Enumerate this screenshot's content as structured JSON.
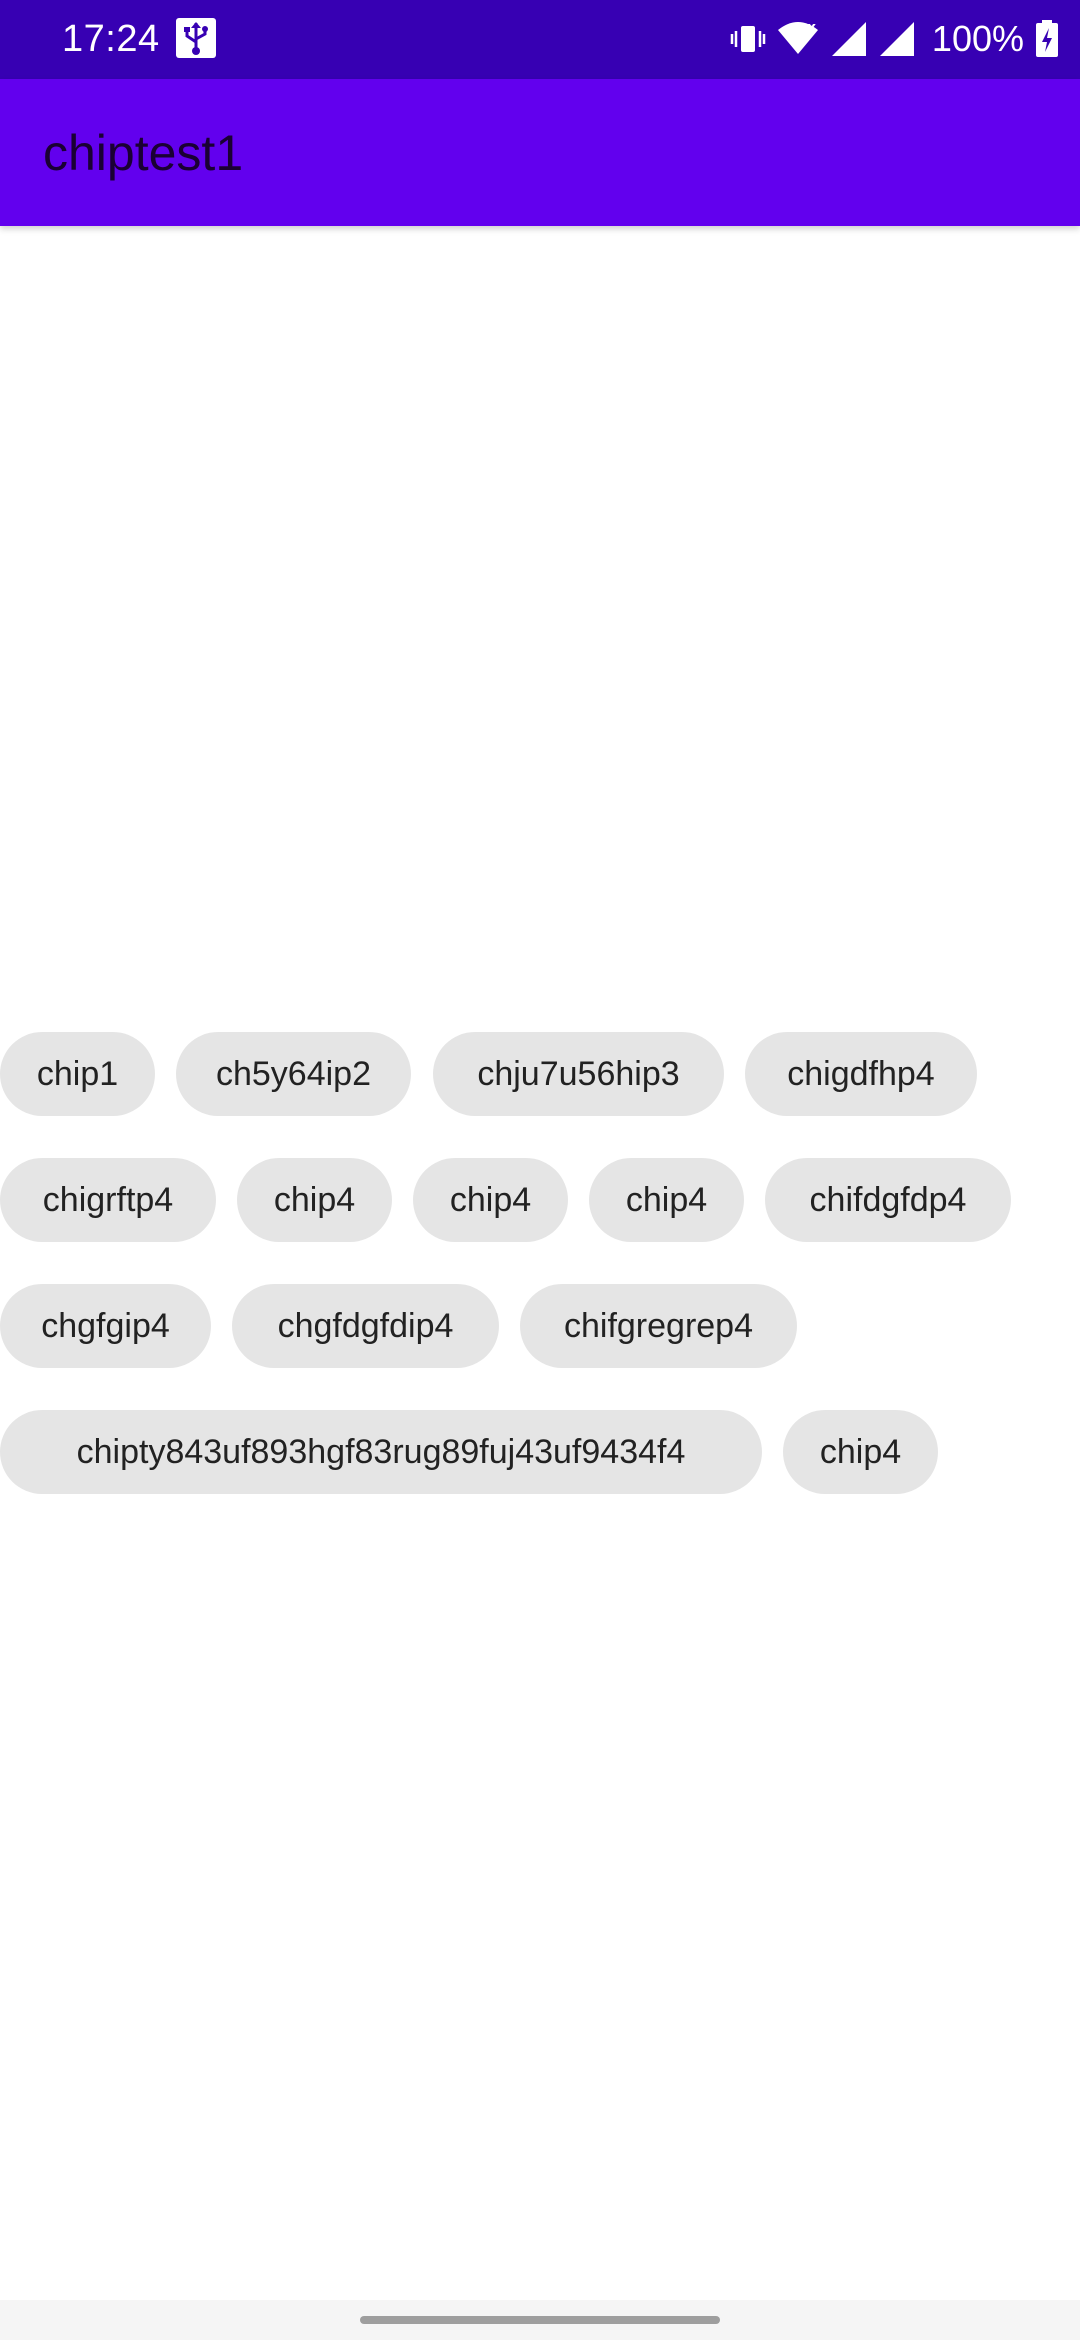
{
  "status_bar": {
    "time": "17:24",
    "battery_percent": "100%",
    "icons": [
      "usb-icon",
      "vibrate-icon",
      "wifi-icon",
      "signal-icon",
      "signal-icon",
      "battery-charging-icon"
    ]
  },
  "app_bar": {
    "title": "chiptest1"
  },
  "chips": [
    {
      "label": "chip1"
    },
    {
      "label": "ch5y64ip2"
    },
    {
      "label": "chju7u56hip3"
    },
    {
      "label": "chigdfhp4"
    },
    {
      "label": "chigrftp4"
    },
    {
      "label": "chip4"
    },
    {
      "label": "chip4"
    },
    {
      "label": "chip4"
    },
    {
      "label": "chifdgfdp4"
    },
    {
      "label": "chgfgip4"
    },
    {
      "label": "chgfdgfdip4"
    },
    {
      "label": "chifgregrep4"
    },
    {
      "label": "chipty843uf893hgf83rug89fuj43uf9434f4"
    },
    {
      "label": "chip4"
    }
  ],
  "colors": {
    "status_bar": "#3700B3",
    "app_bar": "#6200EE",
    "chip_background": "#E5E5E5",
    "chip_text": "#222222"
  }
}
